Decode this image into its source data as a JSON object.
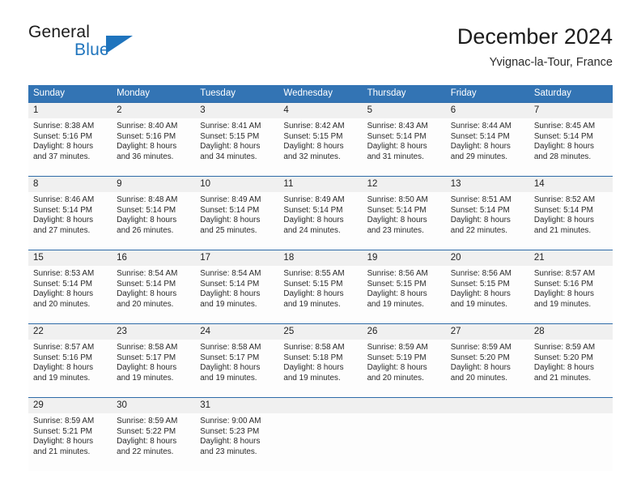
{
  "brand": {
    "name_part1": "General",
    "name_part2": "Blue",
    "triangle_icon": "blue-triangle-icon",
    "accent_color": "#1f74bd"
  },
  "header": {
    "title": "December 2024",
    "subtitle": "Yvignac-la-Tour, France"
  },
  "colors": {
    "header_blue": "#3374b4",
    "row_divider_blue": "#2e6ba8",
    "daynum_band": "#f0f0f0",
    "cell_bg": "#fdfdfd",
    "text": "#2a2a2a"
  },
  "weekdays": [
    "Sunday",
    "Monday",
    "Tuesday",
    "Wednesday",
    "Thursday",
    "Friday",
    "Saturday"
  ],
  "weeks": [
    {
      "days": [
        {
          "num": "1",
          "l1": "Sunrise: 8:38 AM",
          "l2": "Sunset: 5:16 PM",
          "l3": "Daylight: 8 hours",
          "l4": "and 37 minutes."
        },
        {
          "num": "2",
          "l1": "Sunrise: 8:40 AM",
          "l2": "Sunset: 5:16 PM",
          "l3": "Daylight: 8 hours",
          "l4": "and 36 minutes."
        },
        {
          "num": "3",
          "l1": "Sunrise: 8:41 AM",
          "l2": "Sunset: 5:15 PM",
          "l3": "Daylight: 8 hours",
          "l4": "and 34 minutes."
        },
        {
          "num": "4",
          "l1": "Sunrise: 8:42 AM",
          "l2": "Sunset: 5:15 PM",
          "l3": "Daylight: 8 hours",
          "l4": "and 32 minutes."
        },
        {
          "num": "5",
          "l1": "Sunrise: 8:43 AM",
          "l2": "Sunset: 5:14 PM",
          "l3": "Daylight: 8 hours",
          "l4": "and 31 minutes."
        },
        {
          "num": "6",
          "l1": "Sunrise: 8:44 AM",
          "l2": "Sunset: 5:14 PM",
          "l3": "Daylight: 8 hours",
          "l4": "and 29 minutes."
        },
        {
          "num": "7",
          "l1": "Sunrise: 8:45 AM",
          "l2": "Sunset: 5:14 PM",
          "l3": "Daylight: 8 hours",
          "l4": "and 28 minutes."
        }
      ]
    },
    {
      "days": [
        {
          "num": "8",
          "l1": "Sunrise: 8:46 AM",
          "l2": "Sunset: 5:14 PM",
          "l3": "Daylight: 8 hours",
          "l4": "and 27 minutes."
        },
        {
          "num": "9",
          "l1": "Sunrise: 8:48 AM",
          "l2": "Sunset: 5:14 PM",
          "l3": "Daylight: 8 hours",
          "l4": "and 26 minutes."
        },
        {
          "num": "10",
          "l1": "Sunrise: 8:49 AM",
          "l2": "Sunset: 5:14 PM",
          "l3": "Daylight: 8 hours",
          "l4": "and 25 minutes."
        },
        {
          "num": "11",
          "l1": "Sunrise: 8:49 AM",
          "l2": "Sunset: 5:14 PM",
          "l3": "Daylight: 8 hours",
          "l4": "and 24 minutes."
        },
        {
          "num": "12",
          "l1": "Sunrise: 8:50 AM",
          "l2": "Sunset: 5:14 PM",
          "l3": "Daylight: 8 hours",
          "l4": "and 23 minutes."
        },
        {
          "num": "13",
          "l1": "Sunrise: 8:51 AM",
          "l2": "Sunset: 5:14 PM",
          "l3": "Daylight: 8 hours",
          "l4": "and 22 minutes."
        },
        {
          "num": "14",
          "l1": "Sunrise: 8:52 AM",
          "l2": "Sunset: 5:14 PM",
          "l3": "Daylight: 8 hours",
          "l4": "and 21 minutes."
        }
      ]
    },
    {
      "days": [
        {
          "num": "15",
          "l1": "Sunrise: 8:53 AM",
          "l2": "Sunset: 5:14 PM",
          "l3": "Daylight: 8 hours",
          "l4": "and 20 minutes."
        },
        {
          "num": "16",
          "l1": "Sunrise: 8:54 AM",
          "l2": "Sunset: 5:14 PM",
          "l3": "Daylight: 8 hours",
          "l4": "and 20 minutes."
        },
        {
          "num": "17",
          "l1": "Sunrise: 8:54 AM",
          "l2": "Sunset: 5:14 PM",
          "l3": "Daylight: 8 hours",
          "l4": "and 19 minutes."
        },
        {
          "num": "18",
          "l1": "Sunrise: 8:55 AM",
          "l2": "Sunset: 5:15 PM",
          "l3": "Daylight: 8 hours",
          "l4": "and 19 minutes."
        },
        {
          "num": "19",
          "l1": "Sunrise: 8:56 AM",
          "l2": "Sunset: 5:15 PM",
          "l3": "Daylight: 8 hours",
          "l4": "and 19 minutes."
        },
        {
          "num": "20",
          "l1": "Sunrise: 8:56 AM",
          "l2": "Sunset: 5:15 PM",
          "l3": "Daylight: 8 hours",
          "l4": "and 19 minutes."
        },
        {
          "num": "21",
          "l1": "Sunrise: 8:57 AM",
          "l2": "Sunset: 5:16 PM",
          "l3": "Daylight: 8 hours",
          "l4": "and 19 minutes."
        }
      ]
    },
    {
      "days": [
        {
          "num": "22",
          "l1": "Sunrise: 8:57 AM",
          "l2": "Sunset: 5:16 PM",
          "l3": "Daylight: 8 hours",
          "l4": "and 19 minutes."
        },
        {
          "num": "23",
          "l1": "Sunrise: 8:58 AM",
          "l2": "Sunset: 5:17 PM",
          "l3": "Daylight: 8 hours",
          "l4": "and 19 minutes."
        },
        {
          "num": "24",
          "l1": "Sunrise: 8:58 AM",
          "l2": "Sunset: 5:17 PM",
          "l3": "Daylight: 8 hours",
          "l4": "and 19 minutes."
        },
        {
          "num": "25",
          "l1": "Sunrise: 8:58 AM",
          "l2": "Sunset: 5:18 PM",
          "l3": "Daylight: 8 hours",
          "l4": "and 19 minutes."
        },
        {
          "num": "26",
          "l1": "Sunrise: 8:59 AM",
          "l2": "Sunset: 5:19 PM",
          "l3": "Daylight: 8 hours",
          "l4": "and 20 minutes."
        },
        {
          "num": "27",
          "l1": "Sunrise: 8:59 AM",
          "l2": "Sunset: 5:20 PM",
          "l3": "Daylight: 8 hours",
          "l4": "and 20 minutes."
        },
        {
          "num": "28",
          "l1": "Sunrise: 8:59 AM",
          "l2": "Sunset: 5:20 PM",
          "l3": "Daylight: 8 hours",
          "l4": "and 21 minutes."
        }
      ]
    },
    {
      "days": [
        {
          "num": "29",
          "l1": "Sunrise: 8:59 AM",
          "l2": "Sunset: 5:21 PM",
          "l3": "Daylight: 8 hours",
          "l4": "and 21 minutes."
        },
        {
          "num": "30",
          "l1": "Sunrise: 8:59 AM",
          "l2": "Sunset: 5:22 PM",
          "l3": "Daylight: 8 hours",
          "l4": "and 22 minutes."
        },
        {
          "num": "31",
          "l1": "Sunrise: 9:00 AM",
          "l2": "Sunset: 5:23 PM",
          "l3": "Daylight: 8 hours",
          "l4": "and 23 minutes."
        },
        {
          "num": "",
          "l1": "",
          "l2": "",
          "l3": "",
          "l4": ""
        },
        {
          "num": "",
          "l1": "",
          "l2": "",
          "l3": "",
          "l4": ""
        },
        {
          "num": "",
          "l1": "",
          "l2": "",
          "l3": "",
          "l4": ""
        },
        {
          "num": "",
          "l1": "",
          "l2": "",
          "l3": "",
          "l4": ""
        }
      ]
    }
  ]
}
